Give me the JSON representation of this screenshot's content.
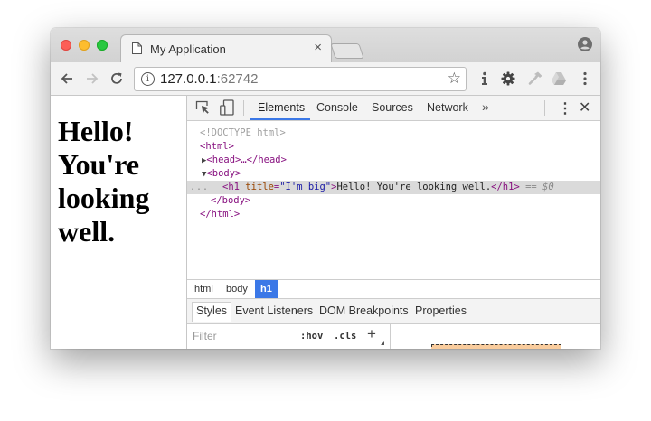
{
  "browser": {
    "tab_title": "My Application",
    "tab_close": "×",
    "url_host": "127.0.0.1",
    "url_port": ":62742"
  },
  "page": {
    "heading": "Hello! You're looking well."
  },
  "devtools": {
    "tabs": [
      "Elements",
      "Console",
      "Sources",
      "Network"
    ],
    "active_tab": "Elements",
    "more_tabs": "»",
    "dom": {
      "doctype": "<!DOCTYPE html>",
      "html_open": "<html>",
      "head": "<head>…</head>",
      "body_open": "<body>",
      "h1_open_tag": "<h1",
      "h1_attr_name": "title",
      "h1_attr_value": "\"I'm big\"",
      "h1_text": "Hello! You're looking well.",
      "h1_close": "</h1>",
      "selected_marker": "== $0",
      "body_close": "</body>",
      "html_close": "</html>",
      "gutter_dots": "..."
    },
    "breadcrumbs": [
      "html",
      "body",
      "h1"
    ],
    "active_breadcrumb": "h1",
    "sidebar_tabs": [
      "Styles",
      "Event Listeners",
      "DOM Breakpoints",
      "Properties"
    ],
    "active_sidebar_tab": "Styles",
    "filter_placeholder": "Filter",
    "hov_label": ":hov",
    "cls_label": ".cls",
    "plus_label": "+"
  },
  "colors": {
    "active_blue": "#3b78e7",
    "tag": "#881280",
    "attr_name": "#994500",
    "attr_value": "#1a1aa6"
  }
}
